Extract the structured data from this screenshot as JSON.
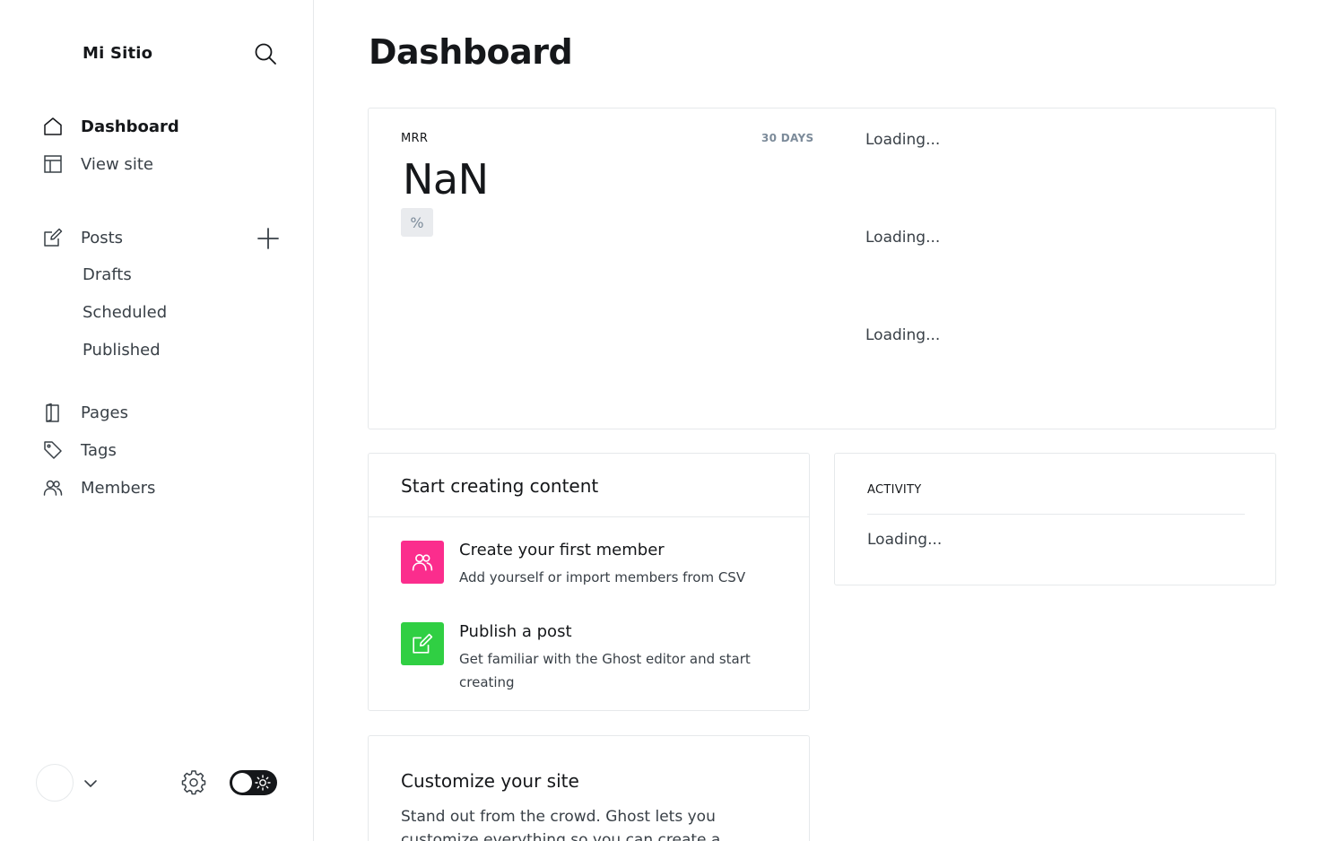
{
  "sidebar": {
    "site_title": "Mi Sitio",
    "search_icon": "search-icon",
    "primary": [
      {
        "label": "Dashboard",
        "icon": "home-icon",
        "active": true
      },
      {
        "label": "View site",
        "icon": "layout-icon",
        "active": false
      }
    ],
    "posts": {
      "label": "Posts",
      "icon": "pencil-icon",
      "add_icon": "plus-icon",
      "sub": [
        "Drafts",
        "Scheduled",
        "Published"
      ]
    },
    "secondary": [
      {
        "label": "Pages",
        "icon": "page-icon"
      },
      {
        "label": "Tags",
        "icon": "tag-icon"
      },
      {
        "label": "Members",
        "icon": "members-icon"
      }
    ],
    "footer": {
      "avatar": "avatar",
      "chevron_icon": "chevron-down-icon",
      "settings_icon": "gear-icon",
      "theme_toggle_icon": "sun-icon",
      "theme": "light"
    }
  },
  "main": {
    "title": "Dashboard",
    "mrr": {
      "label": "MRR",
      "range": "30 DAYS",
      "value": "NaN",
      "badge": "%",
      "loading": [
        "Loading...",
        "Loading...",
        "Loading..."
      ]
    },
    "start": {
      "title": "Start creating content",
      "tasks": [
        {
          "title": "Create your first member",
          "desc": "Add yourself or import members from CSV",
          "icon": "members-icon",
          "color": "#fb2d8d"
        },
        {
          "title": "Publish a post",
          "desc": "Get familiar with the Ghost editor and start creating",
          "icon": "edit-icon",
          "color": "#30cf43"
        }
      ]
    },
    "activity": {
      "label": "ACTIVITY",
      "loading": "Loading..."
    },
    "customize": {
      "title": "Customize your site",
      "desc": "Stand out from the crowd. Ghost lets you customize everything so you can create a publication that"
    }
  }
}
